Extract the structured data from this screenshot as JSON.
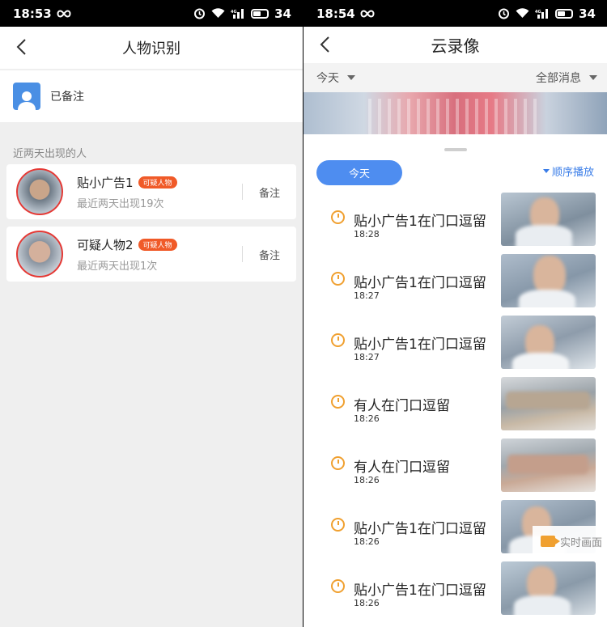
{
  "left": {
    "status": {
      "time": "18:53",
      "battery": "34"
    },
    "title": "人物识别",
    "noted_label": "已备注",
    "section_label": "近两天出现的人",
    "persons": [
      {
        "name": "贴小广告1",
        "badge": "可疑人物",
        "subtitle": "最近两天出现19次",
        "note_label": "备注"
      },
      {
        "name": "可疑人物2",
        "badge": "可疑人物",
        "subtitle": "最近两天出现1次",
        "note_label": "备注"
      }
    ]
  },
  "right": {
    "status": {
      "time": "18:54",
      "battery": "34"
    },
    "title": "云录像",
    "filter_day": "今天",
    "filter_msg": "全部消息",
    "today_pill": "今天",
    "order_play": "顺序播放",
    "live_label": "实时画面",
    "events": [
      {
        "title": "贴小广告1在门口逗留",
        "time": "18:28"
      },
      {
        "title": "贴小广告1在门口逗留",
        "time": "18:27"
      },
      {
        "title": "贴小广告1在门口逗留",
        "time": "18:27"
      },
      {
        "title": "有人在门口逗留",
        "time": "18:26"
      },
      {
        "title": "有人在门口逗留",
        "time": "18:26"
      },
      {
        "title": "贴小广告1在门口逗留",
        "time": "18:26"
      },
      {
        "title": "贴小广告1在门口逗留",
        "time": "18:26"
      }
    ]
  },
  "colors": {
    "accent_blue": "#4e8df0",
    "badge_orange": "#f05a28",
    "clock_orange": "#f0a030",
    "avatar_ring": "#e53935"
  },
  "icons": [
    "back-arrow-icon",
    "infinity-icon",
    "alarm-icon",
    "wifi-icon",
    "signal-icon",
    "battery-icon",
    "person-avatar-icon",
    "clock-icon",
    "dropdown-triangle-icon",
    "camera-icon"
  ]
}
